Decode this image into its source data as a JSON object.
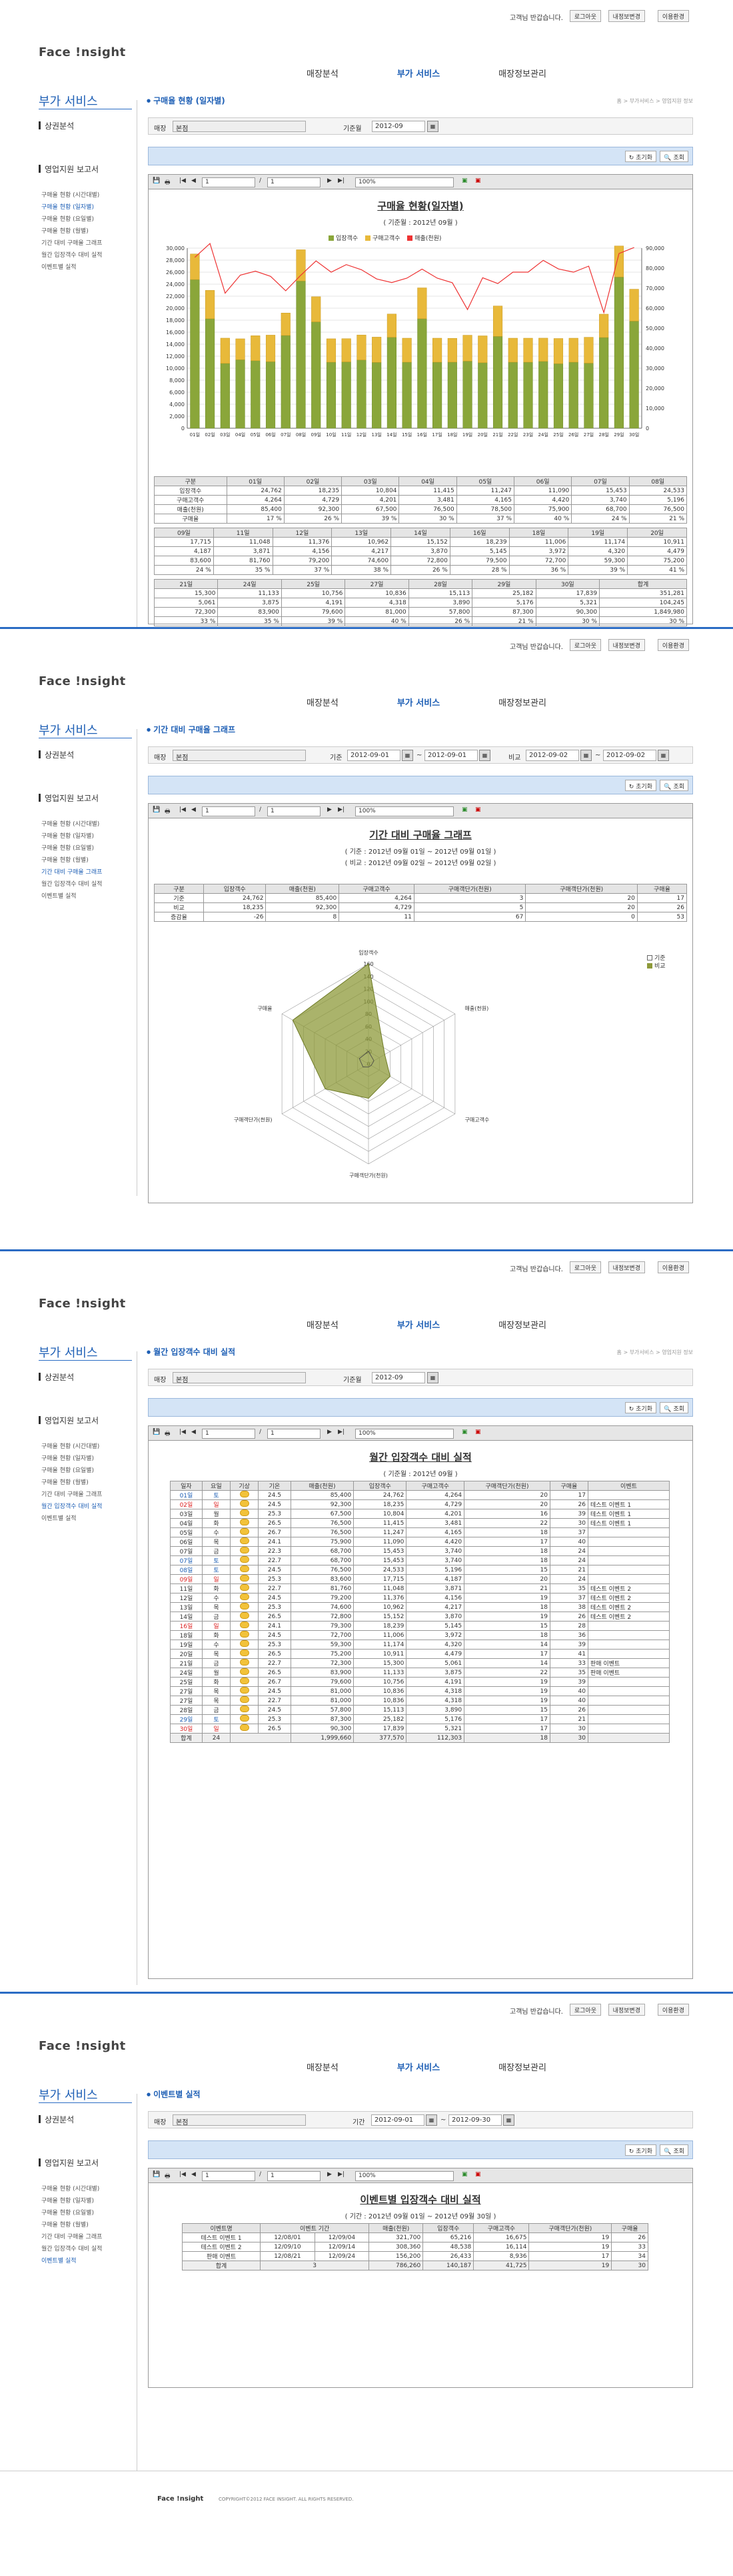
{
  "header": {
    "greeting": "고객님 반갑습니다.",
    "buttons": [
      "로그아웃",
      "내정보변경",
      "이용환경"
    ]
  },
  "logo": "Face !nsight",
  "gnb": [
    "매장분석",
    "부가 서비스",
    "매장정보관리"
  ],
  "lnb": {
    "title": "부가 서비스",
    "sub1": "상권분석",
    "sub2": "영업지원 보고서",
    "items": [
      "구매율 현황 (시간대별)",
      "구매율 현황 (일자별)",
      "구매율 현황 (요일별)",
      "구매율 현황 (월별)",
      "기간 대비 구매율 그래프",
      "월간 입장객수 대비 실적",
      "이벤트별 실적"
    ]
  },
  "crumb": "홈 > 부가서비스 > 영업지원 정보",
  "common": {
    "store_label": "매장",
    "store_value": "본점",
    "search_btn": "조회",
    "init_btn": "초기화",
    "zoom": "100%",
    "page_num": "1",
    "page_of": "1"
  },
  "s1": {
    "page_title": "구매율 현황 (일자별)",
    "date_label": "기준월",
    "date_value": "2012-09",
    "report_title": "구매율 현황(일자별)",
    "report_sub": "( 기준월 : 2012년 09월 )",
    "legend": [
      "입장객수",
      "구매고객수",
      "매출(천원)"
    ],
    "table_rows": [
      {
        "cols": [
          "구분",
          "01일",
          "02일",
          "03일",
          "04일",
          "05일",
          "06일",
          "07일",
          "08일"
        ],
        "rows": [
          [
            "입장객수",
            "24,762",
            "18,235",
            "10,804",
            "11,415",
            "11,247",
            "11,090",
            "15,453",
            "24,533"
          ],
          [
            "구매고객수",
            "4,264",
            "4,729",
            "4,201",
            "3,481",
            "4,165",
            "4,420",
            "3,740",
            "5,196"
          ],
          [
            "매출(천원)",
            "85,400",
            "92,300",
            "67,500",
            "76,500",
            "78,500",
            "75,900",
            "68,700",
            "76,500"
          ],
          [
            "구매율",
            "17 %",
            "26 %",
            "39 %",
            "30 %",
            "37 %",
            "40 %",
            "24 %",
            "21 %"
          ]
        ]
      },
      {
        "cols": [
          "09일",
          "11일",
          "12일",
          "13일",
          "14일",
          "16일",
          "18일",
          "19일",
          "20일"
        ],
        "rows": [
          [
            "17,715",
            "11,048",
            "11,376",
            "10,962",
            "15,152",
            "18,239",
            "11,006",
            "11,174",
            "10,911"
          ],
          [
            "4,187",
            "3,871",
            "4,156",
            "4,217",
            "3,870",
            "5,145",
            "3,972",
            "4,320",
            "4,479"
          ],
          [
            "83,600",
            "81,760",
            "79,200",
            "74,600",
            "72,800",
            "79,500",
            "72,700",
            "59,300",
            "75,200"
          ],
          [
            "24 %",
            "35 %",
            "37 %",
            "38 %",
            "26 %",
            "28 %",
            "36 %",
            "39 %",
            "41 %"
          ]
        ]
      },
      {
        "cols": [
          "21일",
          "24일",
          "25일",
          "27일",
          "28일",
          "29일",
          "30일",
          "합계"
        ],
        "rows": [
          [
            "15,300",
            "11,133",
            "10,756",
            "10,836",
            "15,113",
            "25,182",
            "17,839",
            "351,281"
          ],
          [
            "5,061",
            "3,875",
            "4,191",
            "4,318",
            "3,890",
            "5,176",
            "5,321",
            "104,245"
          ],
          [
            "72,300",
            "83,900",
            "79,600",
            "81,000",
            "57,800",
            "87,300",
            "90,300",
            "1,849,980"
          ],
          [
            "33 %",
            "35 %",
            "39 %",
            "40 %",
            "26 %",
            "21 %",
            "30 %",
            "30 %"
          ]
        ]
      }
    ]
  },
  "chart_data": [
    {
      "type": "bar",
      "title": "구매율 현황(일자별)",
      "categories": [
        "01일",
        "02일",
        "03일",
        "04일",
        "05일",
        "06일",
        "07일",
        "08일",
        "09일",
        "10일",
        "11일",
        "12일",
        "13일",
        "14일",
        "15일",
        "16일",
        "17일",
        "18일",
        "19일",
        "20일",
        "21일",
        "22일",
        "23일",
        "24일",
        "25일",
        "26일",
        "27일",
        "28일",
        "29일",
        "30일"
      ],
      "series": [
        {
          "name": "입장객수",
          "values": [
            24762,
            18235,
            10804,
            11415,
            11247,
            11090,
            15453,
            24533,
            17715,
            11000,
            11048,
            11376,
            10962,
            15152,
            11000,
            18239,
            11000,
            11006,
            11174,
            10911,
            15300,
            11000,
            11000,
            11133,
            10756,
            11000,
            10836,
            15113,
            25182,
            17839
          ]
        },
        {
          "name": "구매고객수",
          "values": [
            4264,
            4729,
            4201,
            3481,
            4165,
            4420,
            3740,
            5196,
            4187,
            3900,
            3871,
            4156,
            4217,
            3870,
            4000,
            5145,
            4000,
            3972,
            4320,
            4479,
            5061,
            4000,
            4000,
            3875,
            4191,
            4000,
            4318,
            3890,
            5176,
            5321
          ]
        },
        {
          "name": "매출(천원)",
          "values": [
            85400,
            92300,
            67500,
            76500,
            78500,
            75900,
            68700,
            76500,
            83600,
            78000,
            81760,
            79200,
            74600,
            72800,
            75000,
            79500,
            75000,
            72700,
            59300,
            75200,
            72300,
            78000,
            78000,
            83900,
            79600,
            78000,
            81000,
            57800,
            87300,
            90300
          ]
        }
      ],
      "ylim": [
        0,
        30000
      ],
      "y2lim": [
        0,
        90000
      ]
    },
    {
      "type": "radar",
      "title": "기간 대비 구매율 그래프",
      "categories": [
        "입장객수",
        "매출(천원)",
        "구매고객수",
        "구매객단가(천원)",
        "구매객단가(천원)",
        "구매율"
      ],
      "series": [
        {
          "name": "기준",
          "values": [
            20,
            10,
            5,
            5,
            10,
            17
          ]
        },
        {
          "name": "비교",
          "values": [
            160,
            30,
            40,
            55,
            80,
            140
          ]
        }
      ],
      "ylim": [
        0,
        160
      ]
    }
  ],
  "s2": {
    "page_title": "기간 대비 구매율 그래프",
    "base_label": "기준",
    "base_from": "2012-09-01",
    "base_to": "2012-09-01",
    "cmp_label": "비교",
    "cmp_from": "2012-09-02",
    "cmp_to": "2012-09-02",
    "report_title": "기간 대비 구매율 그래프",
    "report_sub1": "( 기준 : 2012년 09월 01일 ~ 2012년 09월 01일 )",
    "report_sub2": "( 비교 : 2012년 09월 02일 ~ 2012년 09월 02일 )",
    "cols": [
      "구분",
      "입장객수",
      "매출(천원)",
      "구매고객수",
      "구매객단가(천원)",
      "구매객단가(천원)",
      "구매율"
    ],
    "rows": [
      [
        "기준",
        "24,762",
        "85,400",
        "4,264",
        "3",
        "20",
        "17"
      ],
      [
        "비교",
        "18,235",
        "92,300",
        "4,729",
        "5",
        "20",
        "26"
      ],
      [
        "증감율",
        "-26",
        "8",
        "11",
        "67",
        "0",
        "53"
      ]
    ],
    "legend": [
      "기준",
      "비교"
    ],
    "radar_axes": [
      "입장객수",
      "매출(천원)",
      "구매고객수",
      "구매객단가(천원)",
      "구매객단가(천원)",
      "구매율"
    ],
    "radar_ticks": [
      "160",
      "140",
      "120",
      "100",
      "80",
      "60",
      "40",
      "20",
      "0"
    ]
  },
  "s3": {
    "page_title": "월간 입장객수 대비 실적",
    "date_label": "기준월",
    "date_value": "2012-09",
    "report_title": "월간 입장객수 대비 실적",
    "report_sub": "( 기준월 : 2012년 09월 )",
    "cols": [
      "일자",
      "요일",
      "기상",
      "기온",
      "매출(천원)",
      "입장객수",
      "구매고객수",
      "구매객단가(천원)",
      "구매율",
      "이벤트"
    ],
    "rows": [
      [
        "01일",
        "토",
        "24.5",
        "85,400",
        "24,762",
        "4,264",
        "20",
        "17",
        ""
      ],
      [
        "02일",
        "일",
        "24.5",
        "92,300",
        "18,235",
        "4,729",
        "20",
        "26",
        "테스트 이벤트 1"
      ],
      [
        "03일",
        "월",
        "25.3",
        "67,500",
        "10,804",
        "4,201",
        "16",
        "39",
        "테스트 이벤트 1"
      ],
      [
        "04일",
        "화",
        "26.5",
        "76,500",
        "11,415",
        "3,481",
        "22",
        "30",
        "테스트 이벤트 1"
      ],
      [
        "05일",
        "수",
        "26.7",
        "76,500",
        "11,247",
        "4,165",
        "18",
        "37",
        ""
      ],
      [
        "06일",
        "목",
        "24.1",
        "75,900",
        "11,090",
        "4,420",
        "17",
        "40",
        ""
      ],
      [
        "07일",
        "금",
        "22.3",
        "68,700",
        "15,453",
        "3,740",
        "18",
        "24",
        ""
      ],
      [
        "07일",
        "토",
        "22.7",
        "68,700",
        "15,453",
        "3,740",
        "18",
        "24",
        ""
      ],
      [
        "08일",
        "토",
        "24.5",
        "76,500",
        "24,533",
        "5,196",
        "15",
        "21",
        ""
      ],
      [
        "09일",
        "일",
        "25.3",
        "83,600",
        "17,715",
        "4,187",
        "20",
        "24",
        ""
      ],
      [
        "11일",
        "화",
        "22.7",
        "81,760",
        "11,048",
        "3,871",
        "21",
        "35",
        "테스트 이벤트 2"
      ],
      [
        "12일",
        "수",
        "24.5",
        "79,200",
        "11,376",
        "4,156",
        "19",
        "37",
        "테스트 이벤트 2"
      ],
      [
        "13일",
        "목",
        "25.3",
        "74,600",
        "10,962",
        "4,217",
        "18",
        "38",
        "테스트 이벤트 2"
      ],
      [
        "14일",
        "금",
        "26.5",
        "72,800",
        "15,152",
        "3,870",
        "19",
        "26",
        "테스트 이벤트 2"
      ],
      [
        "16일",
        "일",
        "24.1",
        "79,300",
        "18,239",
        "5,145",
        "15",
        "28",
        ""
      ],
      [
        "18일",
        "화",
        "24.5",
        "72,700",
        "11,006",
        "3,972",
        "18",
        "36",
        ""
      ],
      [
        "19일",
        "수",
        "25.3",
        "59,300",
        "11,174",
        "4,320",
        "14",
        "39",
        ""
      ],
      [
        "20일",
        "목",
        "26.5",
        "75,200",
        "10,911",
        "4,479",
        "17",
        "41",
        ""
      ],
      [
        "21일",
        "금",
        "22.7",
        "72,300",
        "15,300",
        "5,061",
        "14",
        "33",
        "판매 이벤트"
      ],
      [
        "24일",
        "월",
        "26.5",
        "83,900",
        "11,133",
        "3,875",
        "22",
        "35",
        "판매 이벤트"
      ],
      [
        "25일",
        "화",
        "26.7",
        "79,600",
        "10,756",
        "4,191",
        "19",
        "39",
        ""
      ],
      [
        "27일",
        "목",
        "24.5",
        "81,000",
        "10,836",
        "4,318",
        "19",
        "40",
        ""
      ],
      [
        "27일",
        "목",
        "22.7",
        "81,000",
        "10,836",
        "4,318",
        "19",
        "40",
        ""
      ],
      [
        "28일",
        "금",
        "24.5",
        "57,800",
        "15,113",
        "3,890",
        "15",
        "26",
        ""
      ],
      [
        "29일",
        "토",
        "25.3",
        "87,300",
        "25,182",
        "5,176",
        "17",
        "21",
        ""
      ],
      [
        "30일",
        "일",
        "26.5",
        "90,300",
        "17,839",
        "5,321",
        "17",
        "30",
        ""
      ]
    ],
    "total": [
      "합계",
      "24",
      "1,999,660",
      "377,570",
      "112,303",
      "18",
      "30"
    ]
  },
  "s4": {
    "page_title": "이벤트별 실적",
    "period_label": "기간",
    "from": "2012-09-01",
    "to": "2012-09-30",
    "report_title": "이벤트별 입장객수 대비 실적",
    "report_sub": "( 기간 : 2012년 09월 01일 ~ 2012년 09월 30일 )",
    "cols": [
      "이벤트명",
      "이벤트 기간",
      "",
      "매출(천원)",
      "입장객수",
      "구매고객수",
      "구매객단가(천원)",
      "구매율"
    ],
    "rows": [
      [
        "테스트 이벤트 1",
        "12/08/01",
        "12/09/04",
        "321,700",
        "65,216",
        "16,675",
        "19",
        "26"
      ],
      [
        "테스트 이벤트 2",
        "12/09/10",
        "12/09/14",
        "308,360",
        "48,538",
        "16,114",
        "19",
        "33"
      ],
      [
        "판매 이벤트",
        "12/08/21",
        "12/09/24",
        "156,200",
        "26,433",
        "8,936",
        "17",
        "34"
      ]
    ],
    "total": [
      "합계",
      "3",
      "786,260",
      "140,187",
      "41,725",
      "19",
      "30"
    ]
  },
  "footer": {
    "logo": "Face !nsight",
    "copyright": "COPYRIGHT©2012 FACE INSIGHT. ALL RIGHTS RESERVED."
  }
}
